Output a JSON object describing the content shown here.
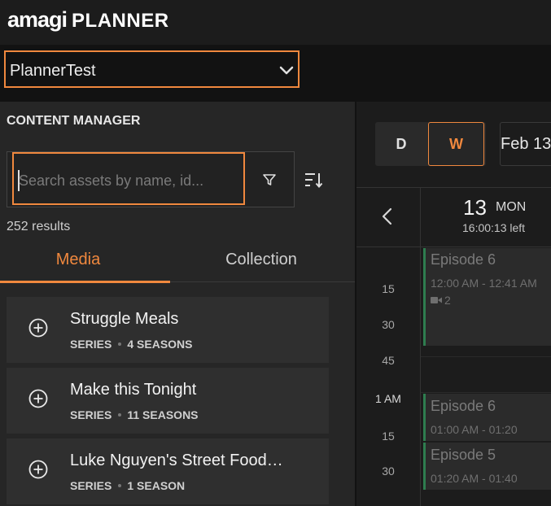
{
  "header": {
    "brand": "amagi",
    "product": "PLANNER"
  },
  "channel_selector": {
    "value": "PlannerTest",
    "icon": "chevron-down-icon"
  },
  "content_manager": {
    "title": "CONTENT MANAGER",
    "search": {
      "placeholder": "Search assets by name, id...",
      "value": ""
    },
    "filter_icon": "filter-icon",
    "sort_icon": "sort-icon",
    "results": "252 results",
    "tabs": [
      {
        "label": "Media",
        "active": true
      },
      {
        "label": "Collection",
        "active": false
      }
    ],
    "items": [
      {
        "title": "Struggle Meals",
        "type": "SERIES",
        "seasons": "4 SEASONS"
      },
      {
        "title": "Make this Tonight",
        "type": "SERIES",
        "seasons": "11 SEASONS"
      },
      {
        "title": "Luke Nguyen's Street Food…",
        "type": "SERIES",
        "seasons": "1 SEASON"
      }
    ]
  },
  "calendar": {
    "views": {
      "day": "D",
      "week": "W",
      "active": "W"
    },
    "date_label": "Feb 13",
    "day": {
      "number": "13",
      "name": "MON",
      "remaining": "16:00:13 left"
    },
    "time_ticks": [
      "15",
      "30",
      "45",
      "1 AM",
      "15",
      "30"
    ],
    "events": [
      {
        "title": "Episode 6",
        "time": "12:00 AM - 12:41 AM",
        "count": "2"
      },
      {
        "title": "Episode 6",
        "time": "01:00 AM - 01:20"
      },
      {
        "title": "Episode 5",
        "time": "01:20 AM - 01:40"
      }
    ]
  },
  "colors": {
    "accent": "#f0883e",
    "event_border": "#2e7d4f",
    "panel": "#262626",
    "background": "#1b1b1b"
  }
}
